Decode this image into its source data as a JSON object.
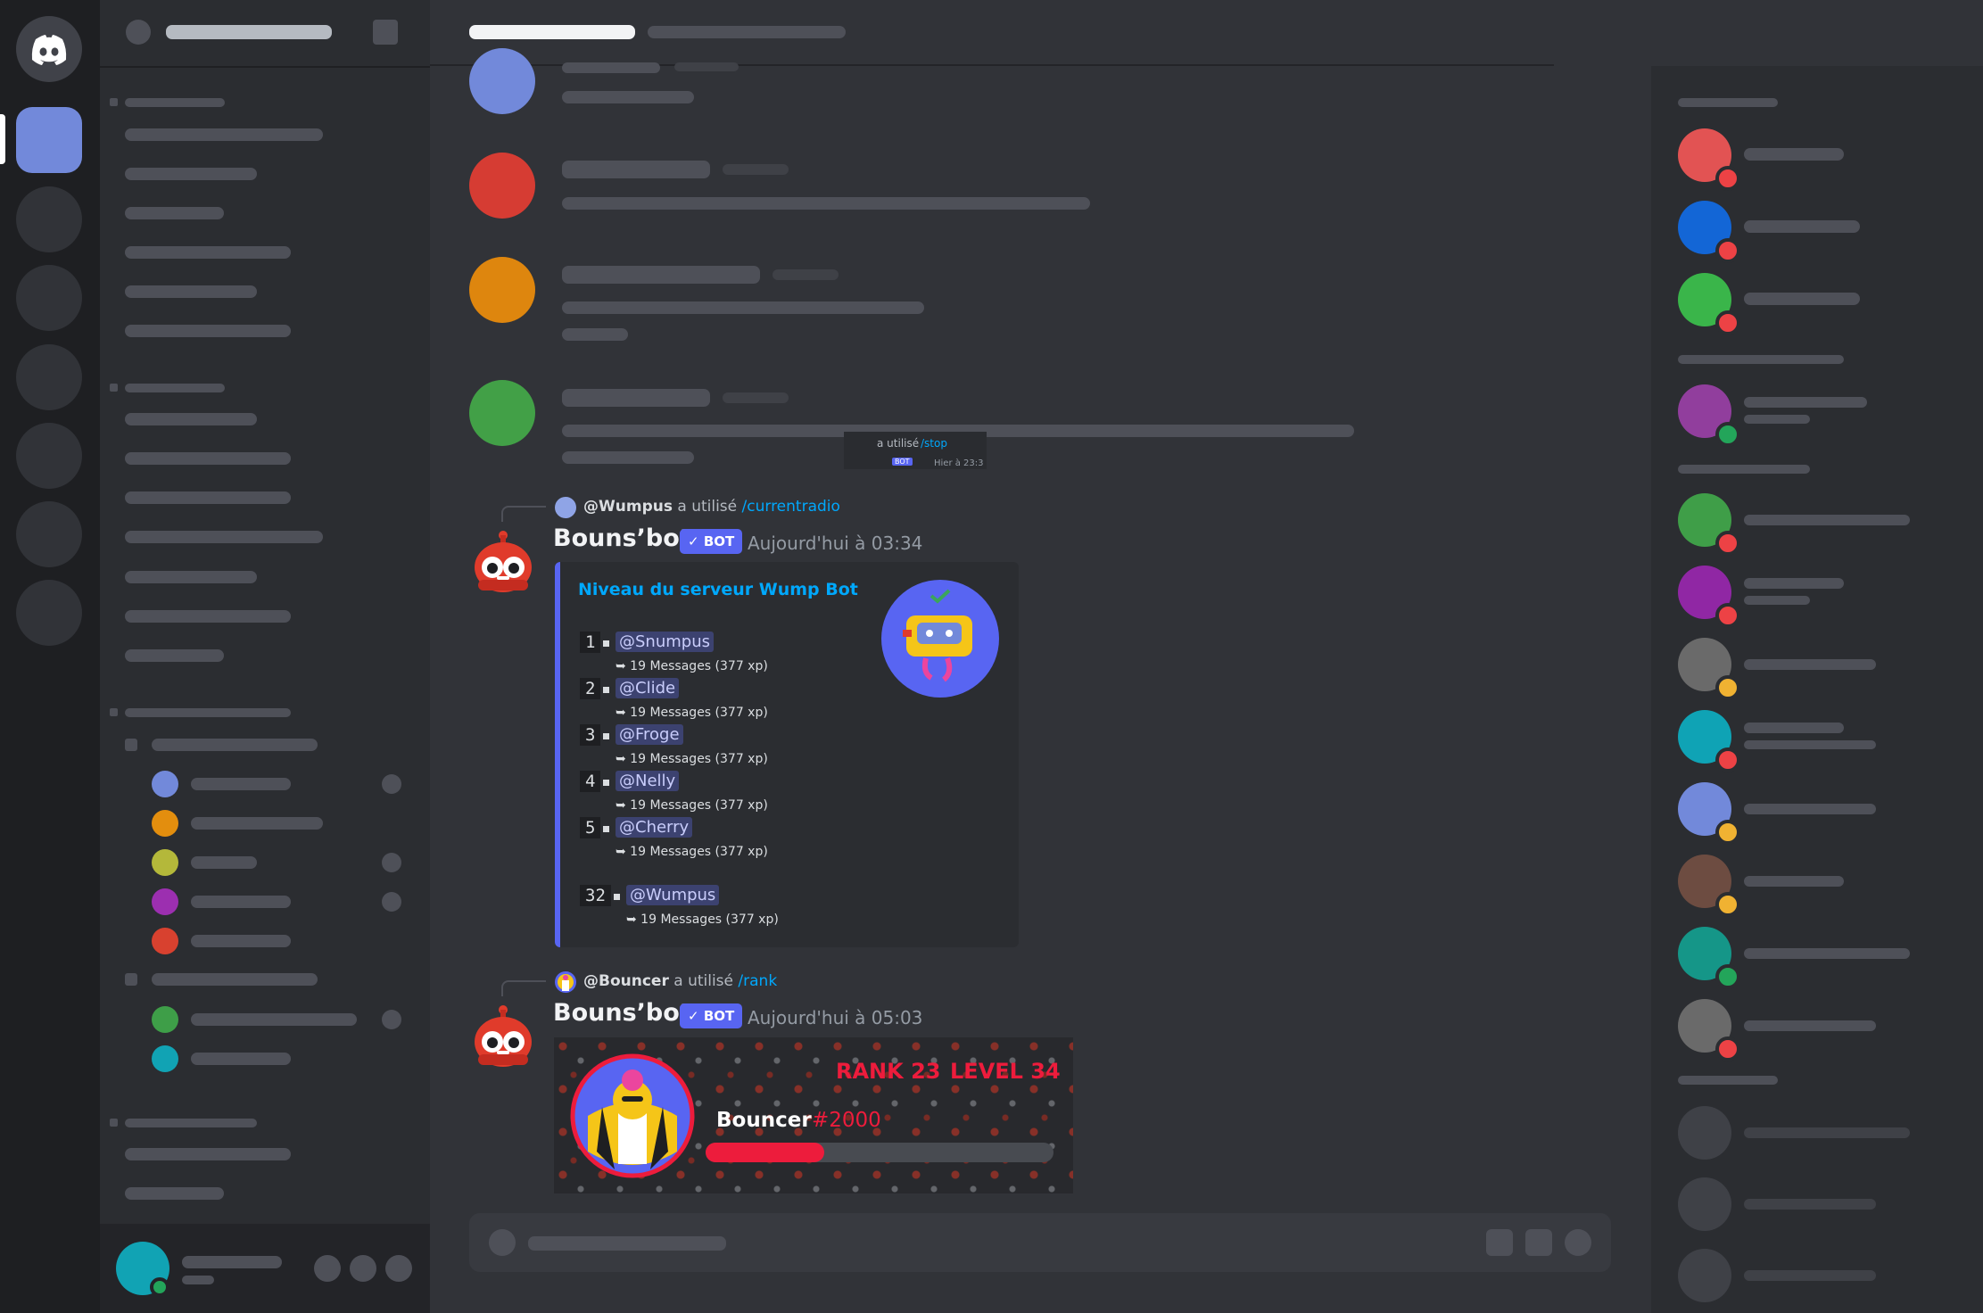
{
  "colors": {
    "accent": "#5865f2",
    "embed_bar": "#5865f2",
    "link": "#00a8fc",
    "danger": "#ed4245",
    "online": "#23a55a",
    "idle": "#f0b232"
  },
  "icons": {
    "home": "discord-logo-icon",
    "bot_badge": "checkmark-icon",
    "reply": "reply-spine-icon"
  },
  "ghost": {
    "command_text": "a utilisé",
    "command": "/stop",
    "bot_tag": "BOT",
    "timestamp": "Hier à 23:3"
  },
  "messages": [
    {
      "reply_user": "@Wumpus",
      "reply_text": "a utilisé",
      "reply_command": "/currentradio",
      "author": "Bouns’bot",
      "bot_tag": "BOT",
      "timestamp": "Aujourd'hui à 03:34",
      "embed": {
        "title": "Niveau du serveur Wump Bot",
        "rows": [
          {
            "rank": "1",
            "user": "@Snumpus",
            "stats": "➥ 19 Messages (377 xp)"
          },
          {
            "rank": "2",
            "user": "@Clide",
            "stats": "➥ 19 Messages (377 xp)"
          },
          {
            "rank": "3",
            "user": "@Froge",
            "stats": "➥ 19 Messages (377 xp)"
          },
          {
            "rank": "4",
            "user": "@Nelly",
            "stats": "➥ 19 Messages (377 xp)"
          },
          {
            "rank": "5",
            "user": "@Cherry",
            "stats": "➥ 19 Messages (377 xp)"
          }
        ],
        "self_row": {
          "rank": "32",
          "user": "@Wumpus",
          "stats": "➥ 19 Messages (377 xp)"
        }
      }
    },
    {
      "reply_user": "@Bouncer",
      "reply_text": "a utilisé",
      "reply_command": "/rank",
      "author": "Bouns’bot",
      "bot_tag": "BOT",
      "timestamp": "Aujourd'hui à 05:03",
      "rank_card": {
        "rank": "RANK 23",
        "level": "LEVEL 34",
        "username": "Bouncer",
        "discriminator": "#2000",
        "progress": 0.34
      }
    }
  ]
}
